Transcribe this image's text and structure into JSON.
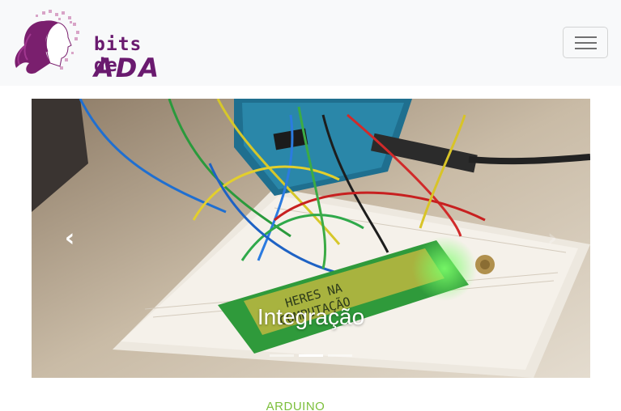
{
  "brand": {
    "line1": "bits de",
    "line2": "ADA"
  },
  "navbar": {
    "toggler_icon": "hamburger-icon"
  },
  "carousel": {
    "caption": "Integração",
    "prev_icon": "chevron-left-icon",
    "next_icon": "chevron-right-icon",
    "indicators": 3,
    "active_index": 1,
    "lcd_text": {
      "line1": "HERES NA",
      "line2": "COMPUTAÇÃO"
    }
  },
  "post": {
    "category": "ARDUINO"
  },
  "colors": {
    "brand": "#6a1a6f",
    "category": "#7cbf3b",
    "navbar_bg": "#f8f9fa"
  }
}
